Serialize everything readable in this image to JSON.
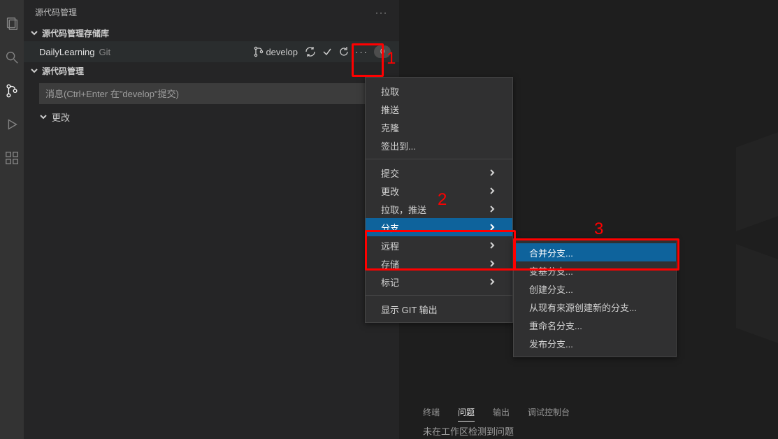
{
  "panel_title": "源代码管理",
  "section_repos": "源代码管理存储库",
  "section_scm": "源代码管理",
  "repo": {
    "name": "DailyLearning",
    "type": "Git",
    "branch": "develop",
    "pending_count": "0"
  },
  "commit_placeholder": "消息(Ctrl+Enter 在\"develop\"提交)",
  "changes_label": "更改",
  "menu1": {
    "pull": "拉取",
    "push": "推送",
    "clone": "克隆",
    "checkout_to": "签出到...",
    "commit": "提交",
    "changes": "更改",
    "pull_push": "拉取，推送",
    "branch": "分支",
    "remote": "远程",
    "stash": "存储",
    "tags": "标记",
    "show_git_output": "显示 GIT 输出"
  },
  "menu2": {
    "merge_branch": "合并分支...",
    "rebase_branch": "变基分支...",
    "create_branch": "创建分支...",
    "create_branch_from": "从现有来源创建新的分支...",
    "rename_branch": "重命名分支...",
    "publish_branch": "发布分支..."
  },
  "bottom": {
    "terminal": "终端",
    "problems": "问题",
    "output": "输出",
    "debug_console": "调试控制台",
    "message": "未在工作区检测到问题"
  },
  "annotations": {
    "n1": "1",
    "n2": "2",
    "n3": "3"
  },
  "icons": {
    "files": "files-icon",
    "search": "search-icon",
    "scm": "source-control-icon",
    "debug": "debug-icon",
    "extensions": "extensions-icon"
  }
}
